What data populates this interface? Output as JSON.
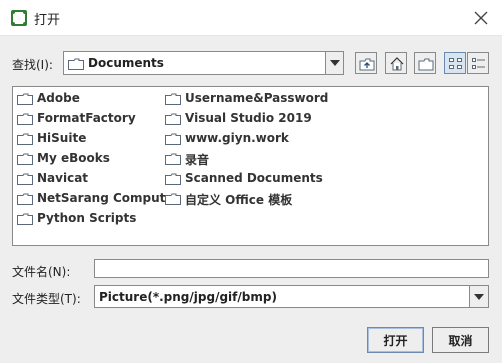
{
  "window": {
    "title": "打开",
    "close_icon": "close-icon",
    "app_icon": "app-icon"
  },
  "lookin": {
    "label": "查找(I):",
    "value": "Documents"
  },
  "toolbar": [
    {
      "name": "up-one-level-button",
      "icon": "up-folder-icon"
    },
    {
      "name": "home-button",
      "icon": "home-icon"
    },
    {
      "name": "new-folder-button",
      "icon": "new-folder-icon"
    },
    {
      "name": "list-view-button",
      "icon": "list-view-icon",
      "active": true
    },
    {
      "name": "details-view-button",
      "icon": "details-view-icon"
    }
  ],
  "files": {
    "col1": [
      "Adobe",
      "FormatFactory",
      "HiSuite",
      "My eBooks",
      "Navicat",
      "NetSarang Computer",
      "Python Scripts"
    ],
    "col2": [
      "Username&Password",
      "Visual Studio 2019",
      "www.giyn.work",
      "录音",
      "Scanned Documents",
      "自定义 Office 模板"
    ]
  },
  "filename": {
    "label": "文件名(N):",
    "value": ""
  },
  "filetype": {
    "label": "文件类型(T):",
    "value": "Picture(*.png/jpg/gif/bmp)"
  },
  "buttons": {
    "open": "打开",
    "cancel": "取消"
  },
  "colors": {
    "accent": "#6a8ab0",
    "folder_outline": "#5a6a7a",
    "app_icon": "#2e7d32"
  }
}
